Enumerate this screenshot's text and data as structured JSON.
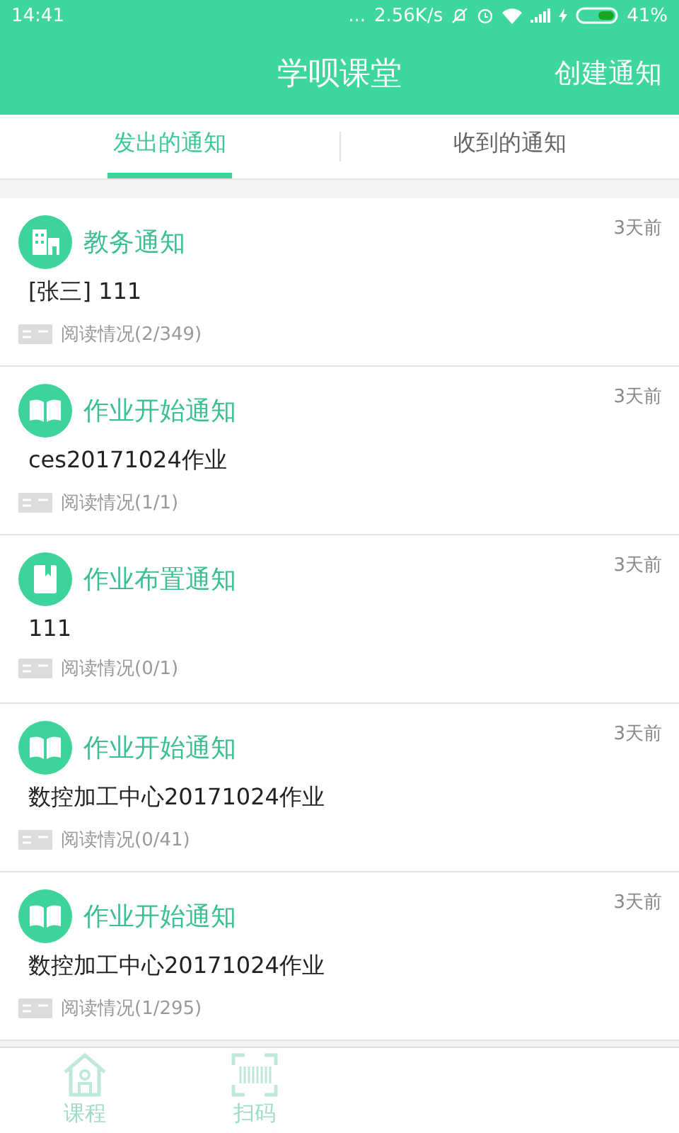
{
  "status_bar": {
    "time": "14:41",
    "dots": "...",
    "speed": "2.56K/s",
    "battery": "41%"
  },
  "header": {
    "title": "学呗课堂",
    "action": "创建通知"
  },
  "tabs": [
    {
      "label": "发出的通知",
      "selected": true
    },
    {
      "label": "收到的通知",
      "selected": false
    }
  ],
  "notices": [
    {
      "kind": "office",
      "type": "教务通知",
      "time": "3天前",
      "content": "[张三] 111",
      "reads": "阅读情况(2/349)"
    },
    {
      "kind": "start",
      "type": "作业开始通知",
      "time": "3天前",
      "content": "ces20171024作业",
      "reads": "阅读情况(1/1)"
    },
    {
      "kind": "assign",
      "type": "作业布置通知",
      "time": "3天前",
      "content": "111",
      "reads": "阅读情况(0/1)"
    },
    {
      "kind": "start",
      "type": "作业开始通知",
      "time": "3天前",
      "content": "数控加工中心20171024作业",
      "reads": "阅读情况(0/41)"
    },
    {
      "kind": "start",
      "type": "作业开始通知",
      "time": "3天前",
      "content": "数控加工中心20171024作业",
      "reads": "阅读情况(1/295)"
    }
  ],
  "bottom_nav": [
    {
      "kind": "course",
      "label": "课程"
    },
    {
      "kind": "scan",
      "label": "扫码"
    }
  ]
}
